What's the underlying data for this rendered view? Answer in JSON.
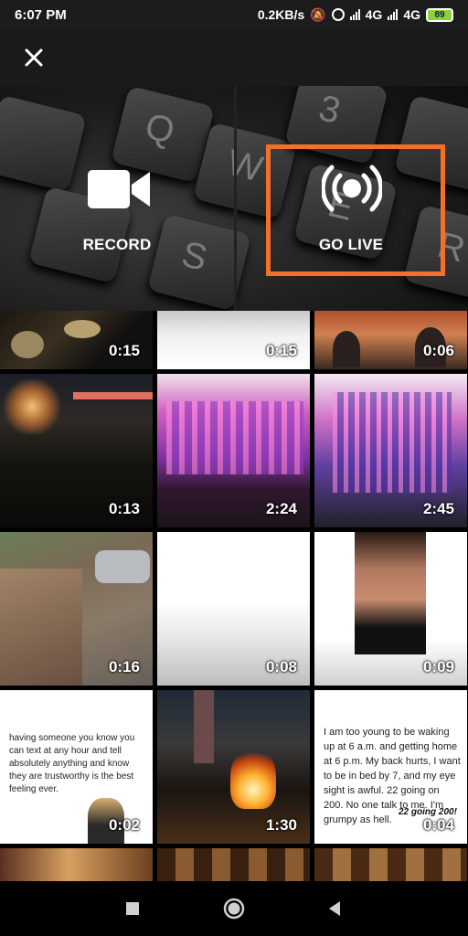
{
  "status_bar": {
    "time": "6:07 PM",
    "net_speed": "0.2KB/s",
    "network_1": "4G",
    "network_2": "4G",
    "battery": "89"
  },
  "top_bar": {
    "close_icon": "close-icon"
  },
  "actions": {
    "record_label": "RECORD",
    "record_icon": "video-camera-icon",
    "live_label": "GO LIVE",
    "live_icon": "broadcast-icon",
    "highlight_color": "#f2702a"
  },
  "media": [
    {
      "duration": "0:15"
    },
    {
      "duration": "0:15"
    },
    {
      "duration": "0:06"
    },
    {
      "duration": "0:13"
    },
    {
      "duration": "2:24"
    },
    {
      "duration": "2:45"
    },
    {
      "duration": "0:16"
    },
    {
      "duration": "0:08"
    },
    {
      "duration": "0:09"
    },
    {
      "duration": "0:02",
      "caption": "having someone you know you can text at any hour and tell absolutely anything and know they are trustworthy is the best feeling ever."
    },
    {
      "duration": "1:30"
    },
    {
      "duration": "0:04",
      "caption": "I am too young to be waking up at 6 a.m. and getting home at 6 p.m. My back hurts, I want to be in bed by 7, and my eye sight is awful. 22 going on 200. No one talk to me. I'm grumpy as hell.",
      "tag": "22 going 200!"
    }
  ],
  "nav": {
    "back_icon": "back-icon",
    "home_icon": "home-icon",
    "recents_icon": "recents-icon"
  }
}
